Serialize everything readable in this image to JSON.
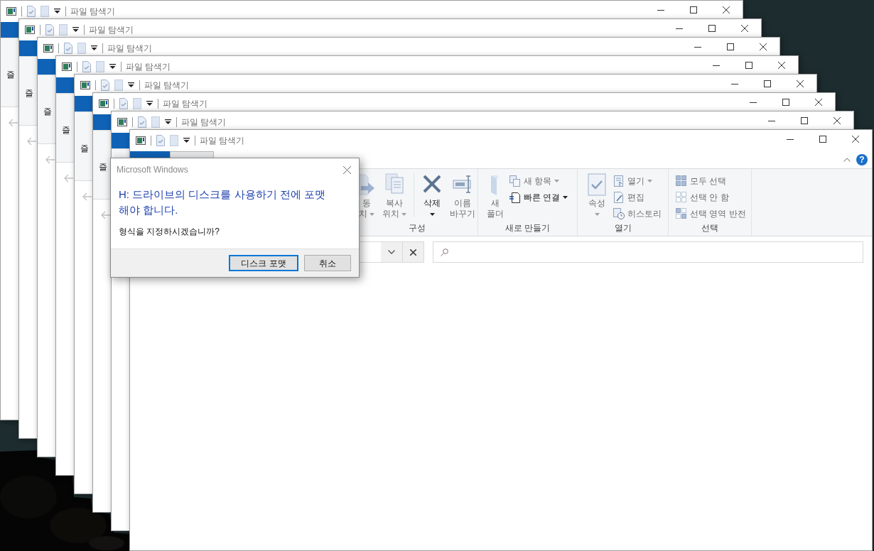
{
  "back_windows": [
    {
      "title": "파일 탐색기",
      "ribbon_text": "즐"
    },
    {
      "title": "파일 탐색기",
      "ribbon_text": "즐"
    },
    {
      "title": "파일 탐색기",
      "ribbon_text": "즐"
    },
    {
      "title": "파일 탐색기",
      "ribbon_text": "즐"
    },
    {
      "title": "파일 탐색기",
      "ribbon_text": "즐"
    },
    {
      "title": "파일 탐색기",
      "ribbon_text": "즐"
    },
    {
      "title": "파일 탐색기"
    }
  ],
  "front_window": {
    "title": "파일 탐색기",
    "tabs": [
      {
        "kind": "file",
        "selected": false
      },
      {
        "kind": "tab",
        "selected": true
      }
    ],
    "help": "?",
    "ribbon_groups": [
      {
        "label": "구성",
        "items": [
          {
            "kind": "large",
            "lines": [
              "동",
              "치"
            ],
            "dropdown": true,
            "disabled": true
          },
          {
            "kind": "large",
            "lines": [
              "복사",
              "위치"
            ],
            "dropdown": true,
            "disabled": true
          },
          {
            "kind": "separator"
          },
          {
            "kind": "large",
            "lines": [
              "삭제"
            ],
            "dropdown": true,
            "disabled": false
          },
          {
            "kind": "large",
            "lines": [
              "이름",
              "바꾸기"
            ],
            "dropdown": false,
            "disabled": true
          }
        ]
      },
      {
        "label": "새로 만들기",
        "items": [
          {
            "kind": "large",
            "lines": [
              "새",
              "폴더"
            ],
            "dropdown": false,
            "disabled": true
          },
          {
            "kind": "small",
            "label": "새 항목",
            "dropdown": true,
            "disabled": true
          },
          {
            "kind": "small",
            "label": "빠른 연결",
            "dropdown": true,
            "disabled": false
          }
        ]
      },
      {
        "label": "열기",
        "items": [
          {
            "kind": "large",
            "lines": [
              "속성"
            ],
            "dropdown": true,
            "disabled": true
          },
          {
            "kind": "small",
            "label": "열기",
            "dropdown": true,
            "disabled": true
          },
          {
            "kind": "small",
            "label": "편집",
            "dropdown": false,
            "disabled": true
          },
          {
            "kind": "small",
            "label": "히스토리",
            "dropdown": false,
            "disabled": true
          }
        ]
      },
      {
        "label": "선택",
        "items": [
          {
            "kind": "small",
            "label": "모두 선택",
            "dropdown": false,
            "disabled": true
          },
          {
            "kind": "small",
            "label": "선택 안 함",
            "dropdown": false,
            "disabled": true
          },
          {
            "kind": "small",
            "label": "선택 영역 반전",
            "dropdown": false,
            "disabled": true
          }
        ]
      }
    ]
  },
  "dialog": {
    "title": "Microsoft Windows",
    "instruction": "H: 드라이브의 디스크를 사용하기 전에 포맷 해야 합니다.",
    "message": "형식을 지정하시겠습니까?",
    "buttons": [
      {
        "label": "디스크 포맷",
        "default": true
      },
      {
        "label": "취소",
        "default": false
      }
    ]
  }
}
